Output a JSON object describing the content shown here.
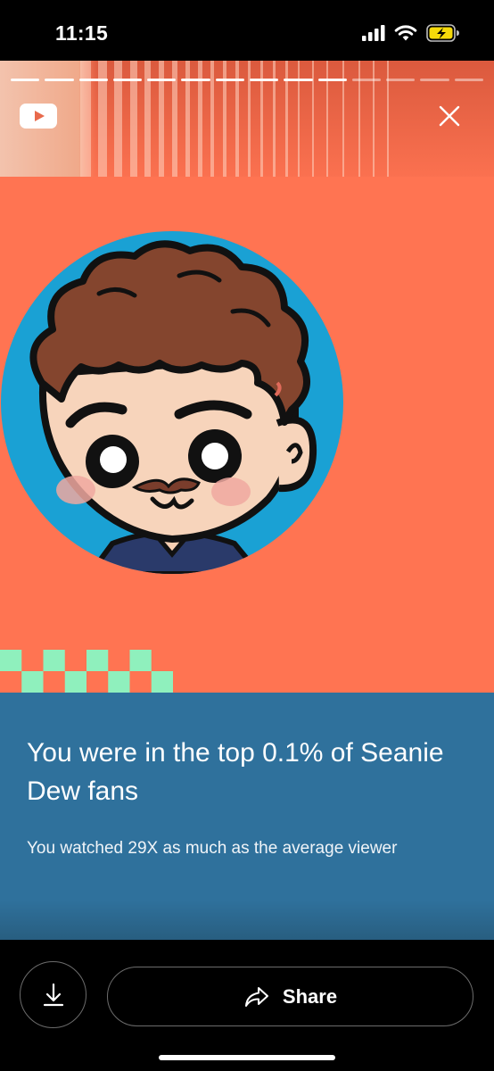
{
  "status_bar": {
    "time": "11:15",
    "icons": [
      "cellular-signal-icon",
      "wifi-icon",
      "battery-charging-icon"
    ],
    "battery_color": "#f5d90a"
  },
  "story": {
    "progress_segments_total": 14,
    "progress_segments_complete": 10,
    "background_color": "#ff7452",
    "panel_color": "#2f719c",
    "checker_color": "#8ff0bd",
    "headline": "You were in the top 0.1% of Seanie Dew fans",
    "subline": "You watched 29X as much as the average viewer"
  },
  "actions": {
    "share_label": "Share",
    "download_icon": "download-icon",
    "share_icon": "share-arrow-icon"
  }
}
